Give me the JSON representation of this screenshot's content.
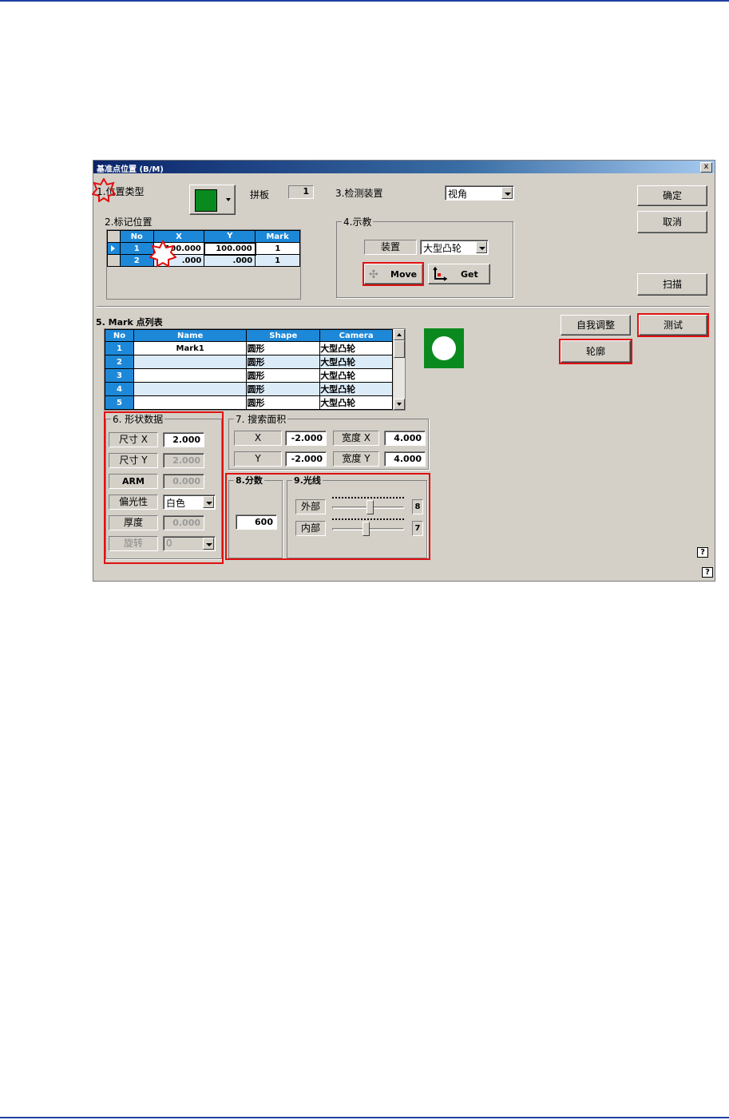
{
  "dialog": {
    "title": "基准点位置 (B/M)",
    "close": "x"
  },
  "section1": {
    "label": "1.位置类型",
    "board_label": "拼板",
    "board_value": "1"
  },
  "section3": {
    "label": "3.检测装置",
    "device_value": "视角"
  },
  "buttons": {
    "ok": "确定",
    "cancel": "取消",
    "scan": "扫描",
    "self_adjust": "自我调整",
    "test": "测试",
    "contour": "轮廓"
  },
  "section2": {
    "label": "2.标记位置",
    "columns": [
      "No",
      "X",
      "Y",
      "Mark"
    ],
    "rows": [
      {
        "no": "1",
        "x": "100.000",
        "y": "100.000",
        "mark": "1"
      },
      {
        "no": "2",
        "x": ".000",
        "y": ".000",
        "mark": "1"
      }
    ]
  },
  "section4": {
    "label": "4.示教",
    "device_label": "装置",
    "device_value": "大型凸轮",
    "move": "Move",
    "get": "Get"
  },
  "section5": {
    "label": "5. Mark 点列表",
    "columns": [
      "No",
      "Name",
      "Shape",
      "Camera"
    ],
    "rows": [
      {
        "no": "1",
        "name": "Mark1",
        "shape": "圆形",
        "camera": "大型凸轮"
      },
      {
        "no": "2",
        "name": "",
        "shape": "圆形",
        "camera": "大型凸轮"
      },
      {
        "no": "3",
        "name": "",
        "shape": "圆形",
        "camera": "大型凸轮"
      },
      {
        "no": "4",
        "name": "",
        "shape": "圆形",
        "camera": "大型凸轮"
      },
      {
        "no": "5",
        "name": "",
        "shape": "圆形",
        "camera": "大型凸轮"
      }
    ]
  },
  "section6": {
    "label": "6. 形状数据",
    "size_x_label": "尺寸 X",
    "size_x": "2.000",
    "size_y_label": "尺寸 Y",
    "size_y": "2.000",
    "arm_label": "ARM",
    "arm": "0.000",
    "polarity_label": "偏光性",
    "polarity": "白色",
    "thickness_label": "厚度",
    "thickness": "0.000",
    "rotation_label": "旋转",
    "rotation": "0"
  },
  "section7": {
    "label": "7. 搜索面积",
    "x_label": "X",
    "x": "-2.000",
    "y_label": "Y",
    "y": "-2.000",
    "width_x_label": "宽度 X",
    "width_x": "4.000",
    "width_y_label": "宽度 Y",
    "width_y": "4.000"
  },
  "section8": {
    "label": "8.分数",
    "score": "600"
  },
  "section9": {
    "label": "9.光线",
    "outer_label": "外部",
    "outer_value": "8",
    "inner_label": "内部",
    "inner_value": "7",
    "outer_level": 0.53,
    "inner_level": 0.47
  },
  "help": "?",
  "colors": {
    "accent": "#1e88d8",
    "highlight": "#e01010",
    "preview": "#0a8a1e"
  }
}
